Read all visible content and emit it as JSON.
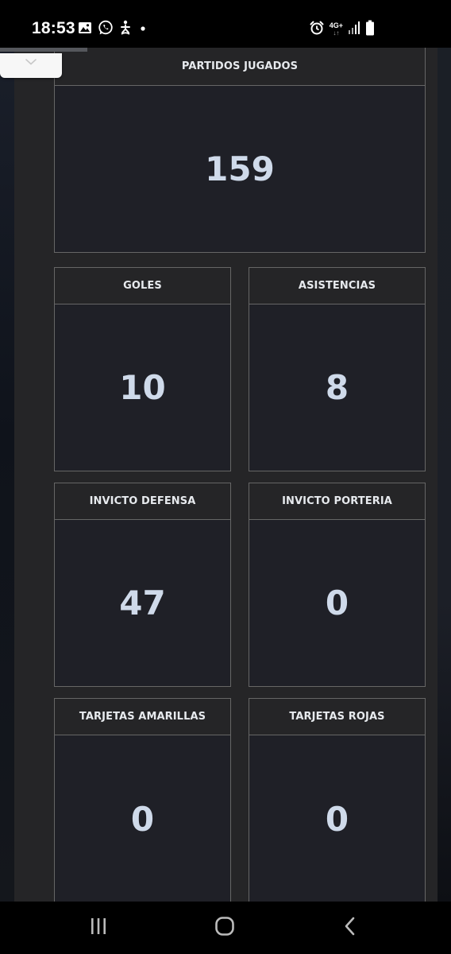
{
  "status_bar": {
    "time": "18:53",
    "network": "4G+",
    "network_arrows": "↓↑",
    "icons_left": [
      "gallery-icon",
      "whatsapp-icon",
      "accessibility-icon",
      "notification-dot-icon"
    ],
    "icons_right": [
      "alarm-icon",
      "signal-icon",
      "battery-icon"
    ]
  },
  "stats": {
    "partidos": {
      "label": "PARTIDOS JUGADOS",
      "value": "159"
    },
    "goles": {
      "label": "GOLES",
      "value": "10"
    },
    "asistencias": {
      "label": "ASISTENCIAS",
      "value": "8"
    },
    "invicto_defensa": {
      "label": "INVICTO DEFENSA",
      "value": "47"
    },
    "invicto_porteria": {
      "label": "INVICTO PORTERIA",
      "value": "0"
    },
    "tarjetas_amarillas": {
      "label": "TARJETAS AMARILLAS",
      "value": "0"
    },
    "tarjetas_rojas": {
      "label": "TARJETAS ROJAS",
      "value": "0"
    }
  },
  "colors": {
    "panel": "#252527",
    "card_body": "#1f2027",
    "border": "#666666",
    "value_text": "#cfdaea",
    "label_text": "#e7eaee"
  },
  "nav_bar": {
    "buttons": [
      "recent-apps-icon",
      "home-icon",
      "back-icon"
    ]
  }
}
